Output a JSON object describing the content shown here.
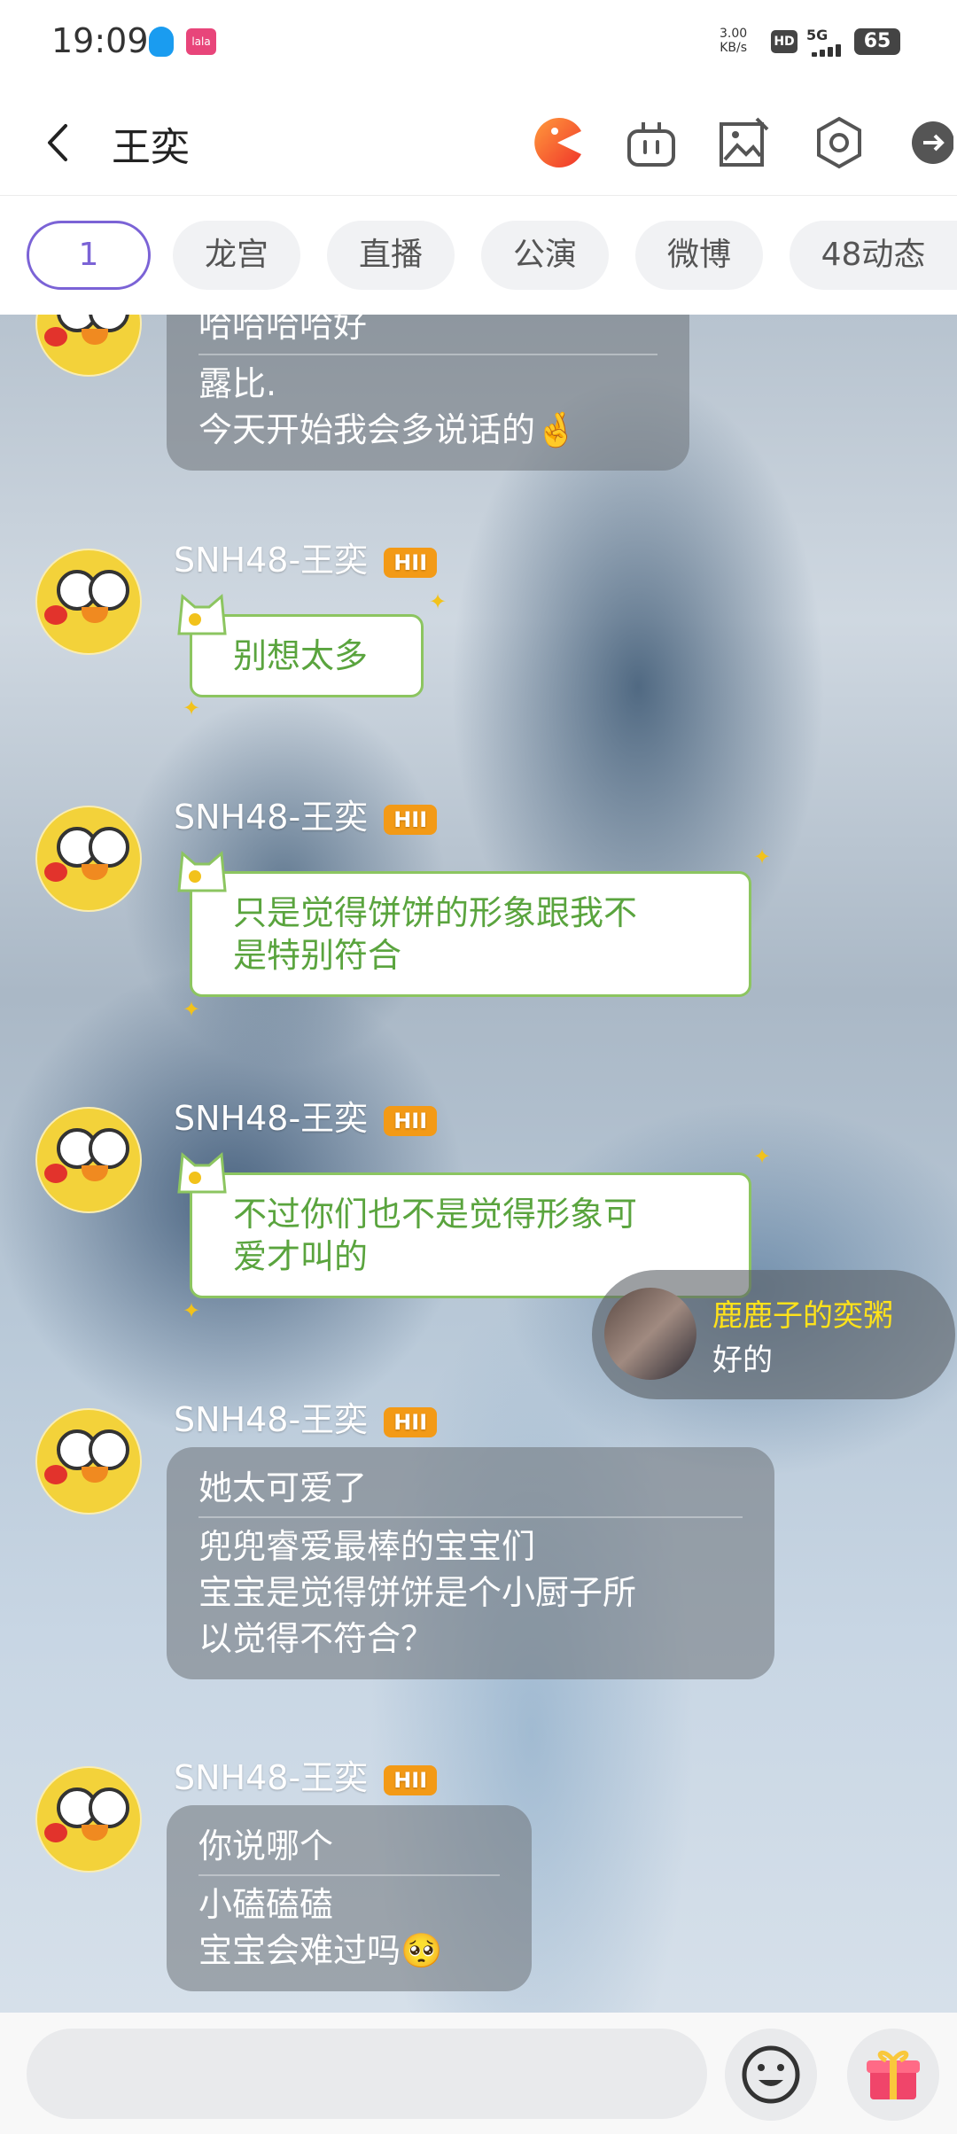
{
  "status_bar": {
    "time": "19:09",
    "net_speed_value": "3.00",
    "net_speed_unit": "KB/s",
    "hd": "HD",
    "network": "5G",
    "battery": "65",
    "app_icon_text": "lala"
  },
  "header": {
    "title": "王奕"
  },
  "tabs": [
    "1",
    "龙宫",
    "直播",
    "公演",
    "微博",
    "48动态"
  ],
  "messages": {
    "m0": {
      "lines": [
        "哈哈哈哈好",
        "露比.",
        "今天开始我会多说话的🤞"
      ]
    },
    "m1": {
      "sender": "SNH48-王奕",
      "badge": "HII",
      "text": "别想太多"
    },
    "m2": {
      "sender": "SNH48-王奕",
      "badge": "HII",
      "line1": "只是觉得饼饼的形象跟我不",
      "line2": "是特别符合"
    },
    "m3": {
      "sender": "SNH48-王奕",
      "badge": "HII",
      "line1": "不过你们也不是觉得形象可",
      "line2": "爱才叫的"
    },
    "m4": {
      "sender": "SNH48-王奕",
      "badge": "HII",
      "quote": "她太可爱了",
      "line1": "兜兜睿爱最棒的宝宝们",
      "line2": "宝宝是觉得饼饼是个小厨子所",
      "line3": "以觉得不符合？"
    },
    "m5": {
      "sender": "SNH48-王奕",
      "badge": "HII",
      "quote": "你说哪个",
      "line1": "小磕磕磕",
      "line2": "宝宝会难过吗🥺"
    }
  },
  "floating_comment": {
    "name": "鹿鹿子的奕粥",
    "text": "好的"
  },
  "icons": [
    "back-icon",
    "pacman-icon",
    "robot-icon",
    "image-icon",
    "settings-icon",
    "exit-icon",
    "emoji-icon",
    "gift-icon"
  ]
}
